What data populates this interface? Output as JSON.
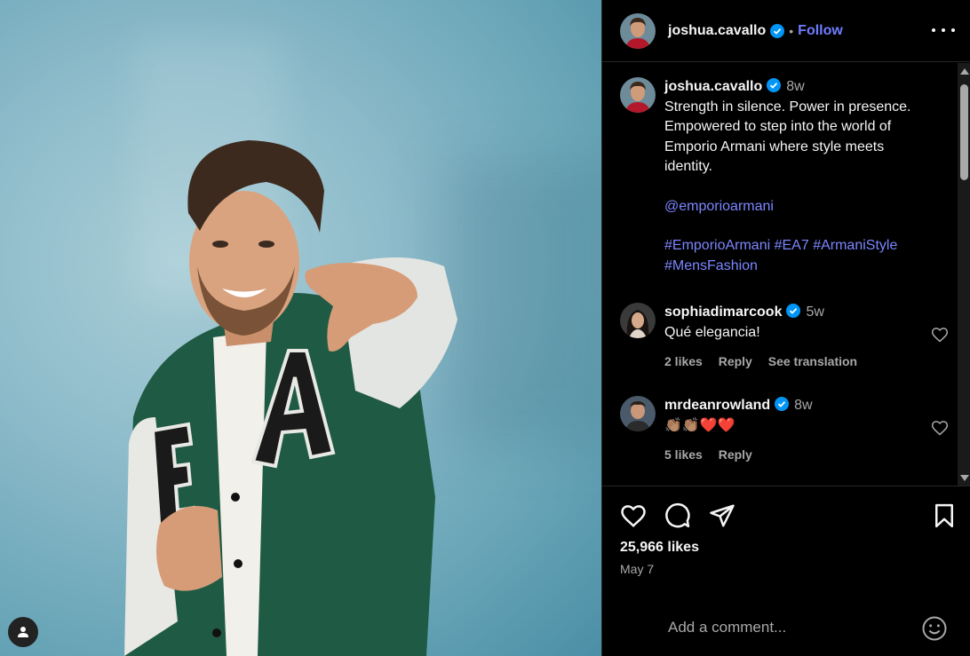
{
  "post": {
    "author": "joshua.cavallo",
    "follow_label": "Follow",
    "separator": "•"
  },
  "caption": {
    "username": "joshua.cavallo",
    "time": "8w",
    "lines": [
      "Strength in silence. Power in presence. Empowered to step into the world of Emporio Armani where style meets identity."
    ],
    "mention": "@emporioarmani",
    "hashtags": "#EmporioArmani #EA7 #ArmaniStyle #MensFashion"
  },
  "comments": [
    {
      "username": "sophiadimarcook",
      "time": "5w",
      "text": "Qué elegancia!",
      "likes": "2 likes",
      "reply": "Reply",
      "translate": "See translation"
    },
    {
      "username": "mrdeanrowland",
      "time": "8w",
      "text": "👏🏽👏🏽❤️❤️",
      "likes": "5 likes",
      "reply": "Reply"
    }
  ],
  "stats": {
    "likes": "25,966 likes",
    "date": "May 7"
  },
  "add_comment": {
    "placeholder": "Add a comment..."
  },
  "colors": {
    "accent": "#6f7cff",
    "verified": "#0095f6",
    "background": "#000000"
  }
}
